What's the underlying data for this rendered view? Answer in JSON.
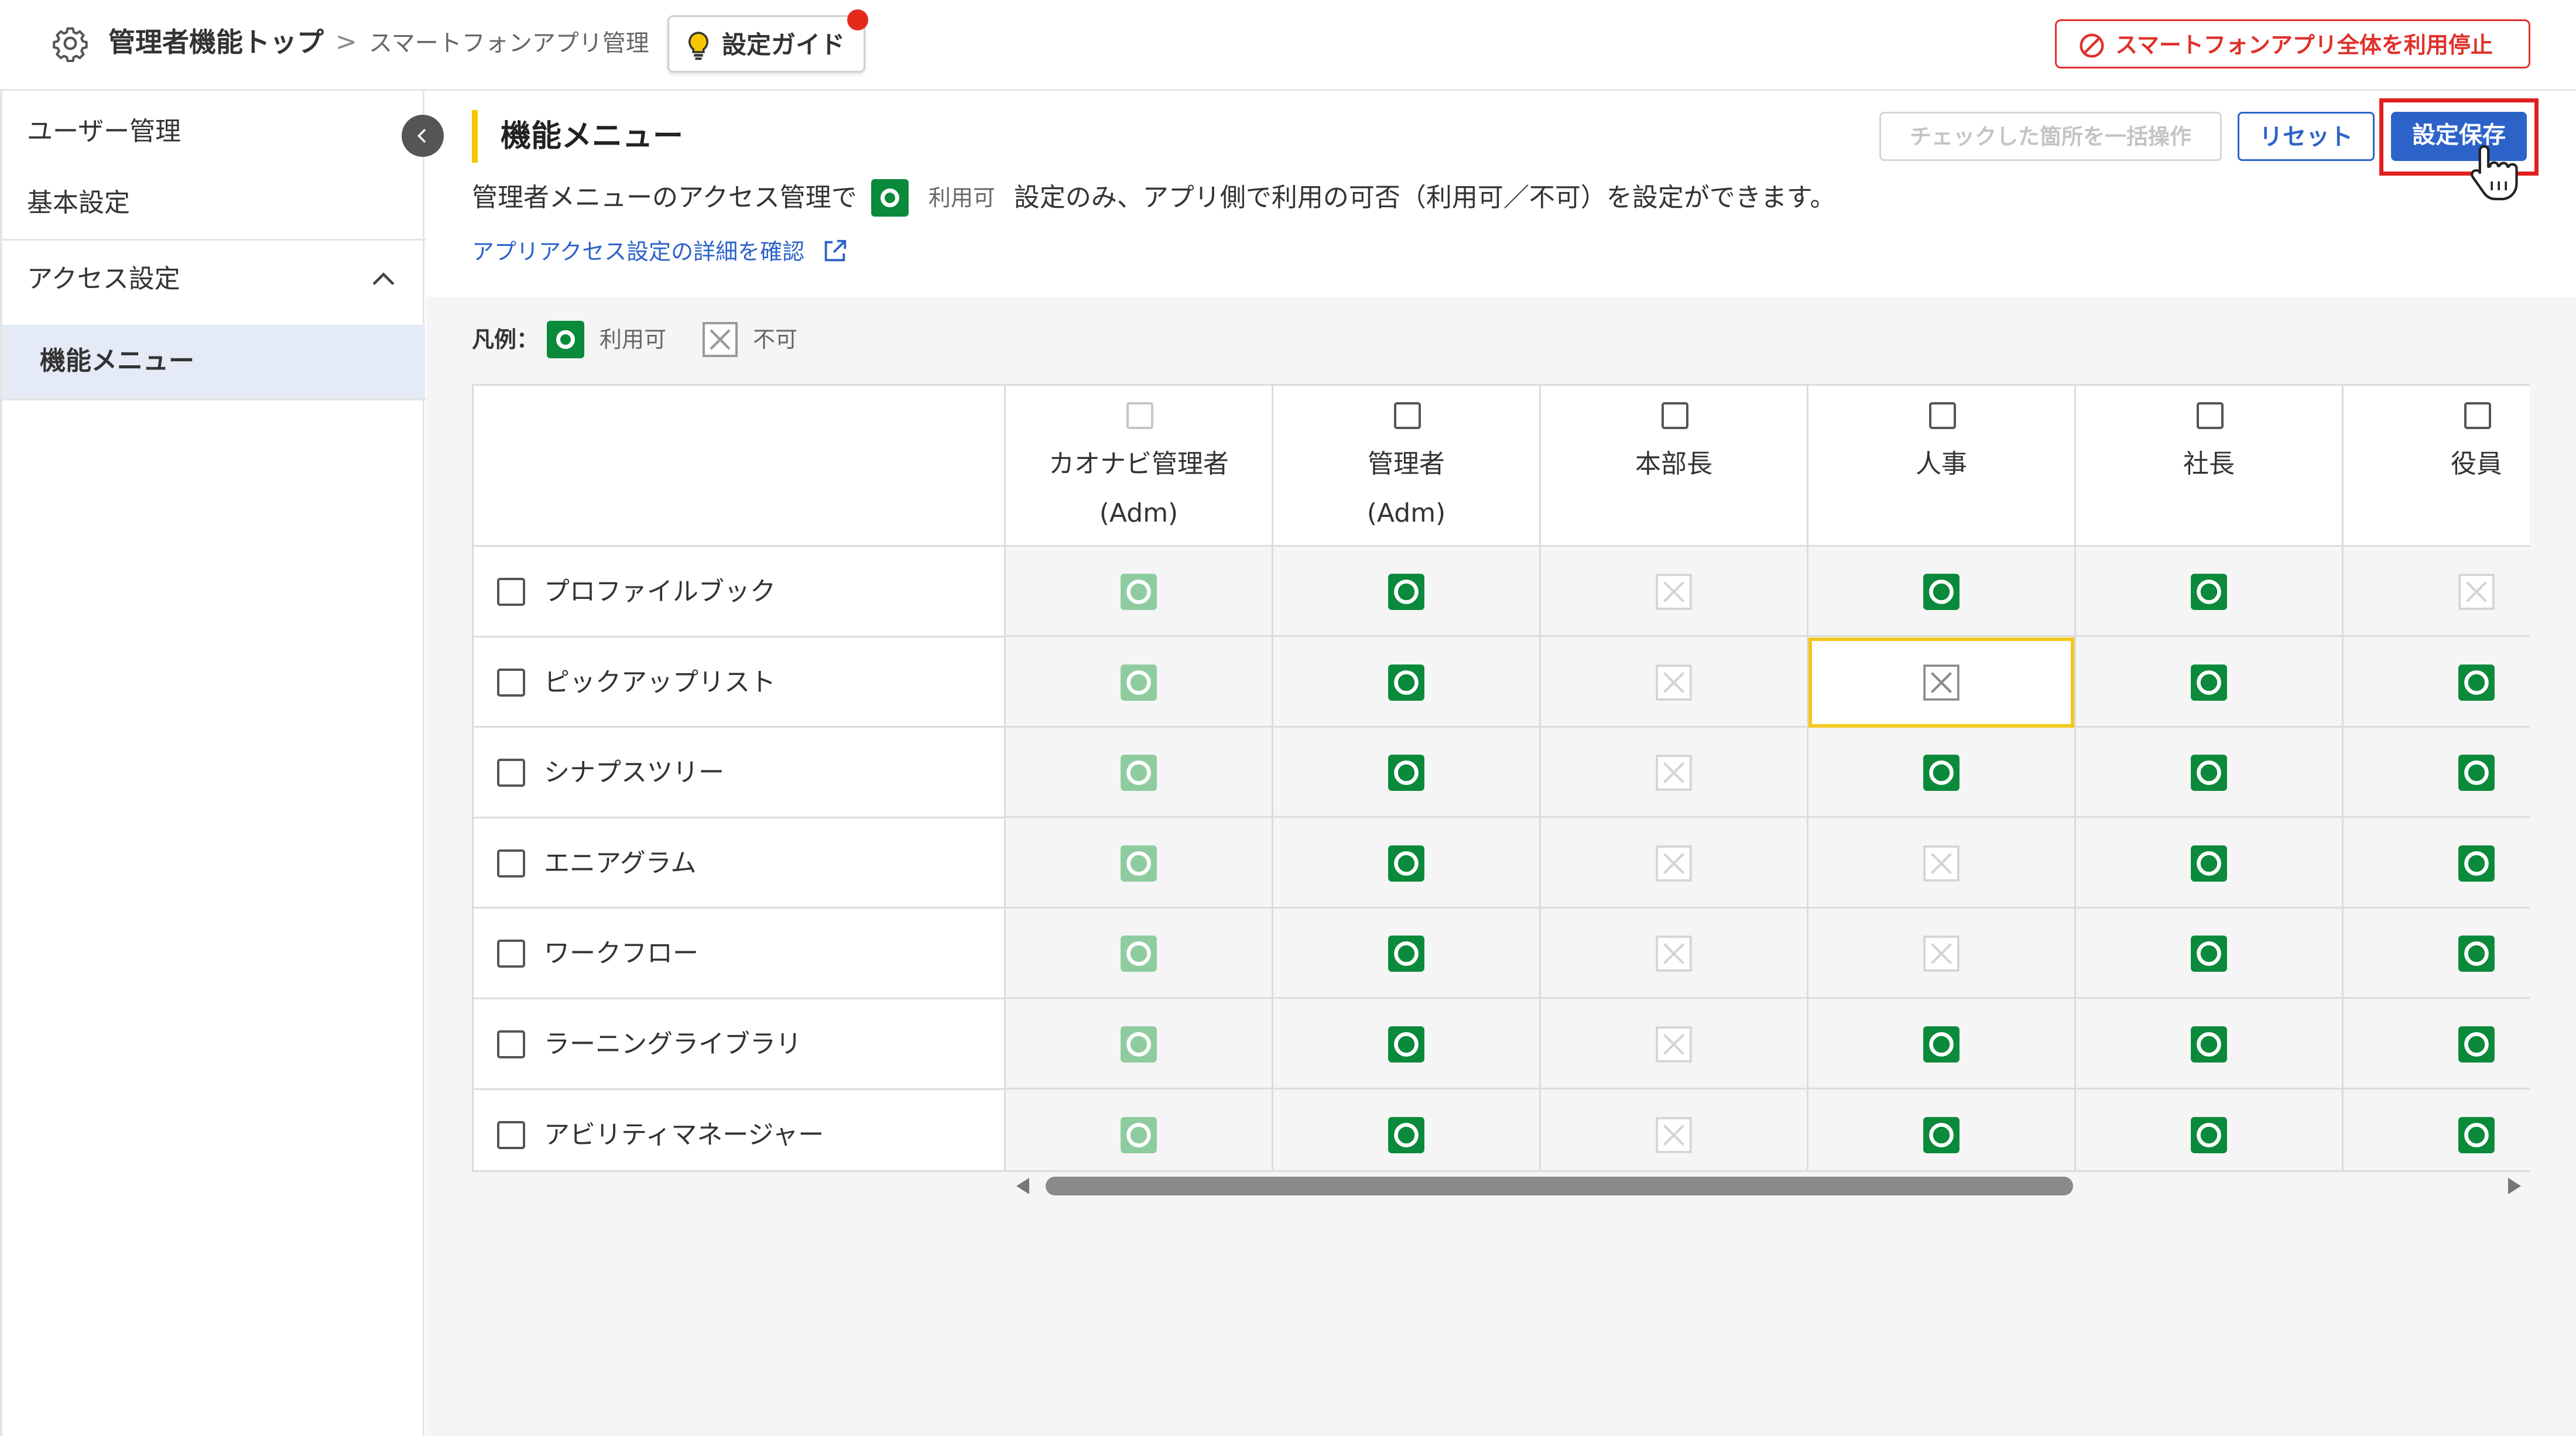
{
  "header": {
    "root_label": "管理者機能トップ",
    "separator": ">",
    "current_label": "スマートフォンアプリ管理",
    "guide_label": "設定ガイド",
    "stop_label": "スマートフォンアプリ全体を利用停止"
  },
  "sidebar": {
    "items": [
      {
        "label": "ユーザー管理"
      },
      {
        "label": "基本設定"
      }
    ],
    "section_label": "アクセス設定",
    "active_item_label": "機能メニュー"
  },
  "main": {
    "title": "機能メニュー",
    "bulk_label": "チェックした箇所を一括操作",
    "reset_label": "リセット",
    "save_label": "設定保存",
    "desc_before": "管理者メニューのアクセス管理で",
    "desc_badge_label": "利用可",
    "desc_after": "設定のみ、アプリ側で利用の可否（利用可／不可）を設定ができます。",
    "link_label": "アプリアクセス設定の詳細を確認"
  },
  "legend": {
    "label": "凡例：",
    "ok_label": "利用可",
    "ng_label": "不可"
  },
  "table": {
    "columns": [
      {
        "name": "カオナビ管理者\n(Adm)",
        "checkbox_disabled": true
      },
      {
        "name": "管理者\n(Adm)",
        "checkbox_disabled": false
      },
      {
        "name": "本部長",
        "checkbox_disabled": false
      },
      {
        "name": "人事",
        "checkbox_disabled": false
      },
      {
        "name": "社長",
        "checkbox_disabled": false
      },
      {
        "name": "役員",
        "checkbox_disabled": false
      }
    ],
    "rows": [
      {
        "label": "プロファイルブック",
        "cells": [
          "ok-disabled",
          "ok",
          "ng-disabled",
          "ok",
          "ok",
          "ng-disabled"
        ]
      },
      {
        "label": "ピックアップリスト",
        "cells": [
          "ok-disabled",
          "ok",
          "ng-disabled",
          "ng",
          "ok",
          "ok"
        ]
      },
      {
        "label": "シナプスツリー",
        "cells": [
          "ok-disabled",
          "ok",
          "ng-disabled",
          "ok",
          "ok",
          "ok"
        ]
      },
      {
        "label": "エニアグラム",
        "cells": [
          "ok-disabled",
          "ok",
          "ng-disabled",
          "ng-disabled",
          "ok",
          "ok"
        ]
      },
      {
        "label": "ワークフロー",
        "cells": [
          "ok-disabled",
          "ok",
          "ng-disabled",
          "ng-disabled",
          "ok",
          "ok"
        ]
      },
      {
        "label": "ラーニングライブラリ",
        "cells": [
          "ok-disabled",
          "ok",
          "ng-disabled",
          "ok",
          "ok",
          "ok"
        ]
      },
      {
        "label": "アビリティマネージャー",
        "cells": [
          "ok-disabled",
          "ok",
          "ng-disabled",
          "ok",
          "ok",
          "ok"
        ]
      }
    ],
    "focused_cell": {
      "row": 1,
      "col": 3
    }
  },
  "colors": {
    "accent": "#2d63c8",
    "ok_green": "#0a8a3a",
    "ok_disabled": "#8ecc9f",
    "danger": "#e0302a",
    "focus_yellow": "#f2c81c",
    "title_bar": "#f7c600"
  },
  "icons": {
    "settings": "gear-icon",
    "guide": "lightbulb-icon",
    "stop": "no-entry-icon",
    "collapse": "chevron-left-icon",
    "section": "chevron-up-icon",
    "link": "external-link-icon",
    "ok": "circle-check-icon",
    "ng": "x-box-icon"
  }
}
